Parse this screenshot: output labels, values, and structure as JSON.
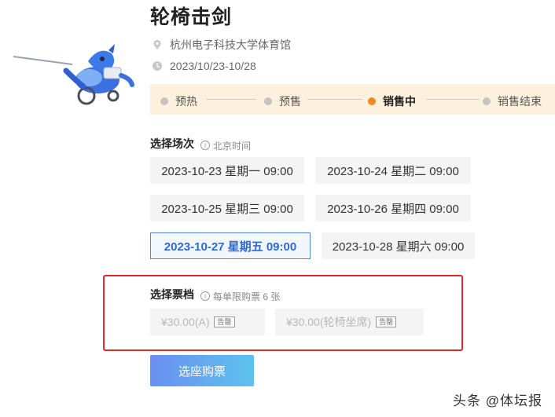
{
  "event": {
    "title": "轮椅击剑",
    "venue": "杭州电子科技大学体育馆",
    "date": "2023/10/23-10/28"
  },
  "progress": {
    "stages": [
      "预热",
      "预售",
      "销售中",
      "销售结束"
    ],
    "active_stage": "销售中",
    "active_color": "#f08a24"
  },
  "session_section": {
    "label": "选择场次",
    "hint": "北京时间",
    "sessions": [
      {
        "label": "2023-10-23 星期一 09:00",
        "selected": false
      },
      {
        "label": "2023-10-24 星期二 09:00",
        "selected": false
      },
      {
        "label": "2023-10-25 星期三 09:00",
        "selected": false
      },
      {
        "label": "2023-10-26 星期四 09:00",
        "selected": false
      },
      {
        "label": "2023-10-27 星期五 09:00",
        "selected": true
      },
      {
        "label": "2023-10-28 星期六 09:00",
        "selected": false
      }
    ]
  },
  "ticket_section": {
    "label": "选择票档",
    "hint": "每单限购票 6 张",
    "tiers": [
      {
        "label": "¥30.00(A)",
        "tag": "告罄"
      },
      {
        "label": "¥30.00(轮椅坐席)",
        "tag": "告罄"
      }
    ]
  },
  "actions": {
    "buy_label": "选座购票"
  },
  "watermark": "头条 @体坛报",
  "colors": {
    "accent_blue": "#2b6bd8",
    "highlight_red": "#e0292c",
    "progress_bg": "#fdf1dd"
  }
}
